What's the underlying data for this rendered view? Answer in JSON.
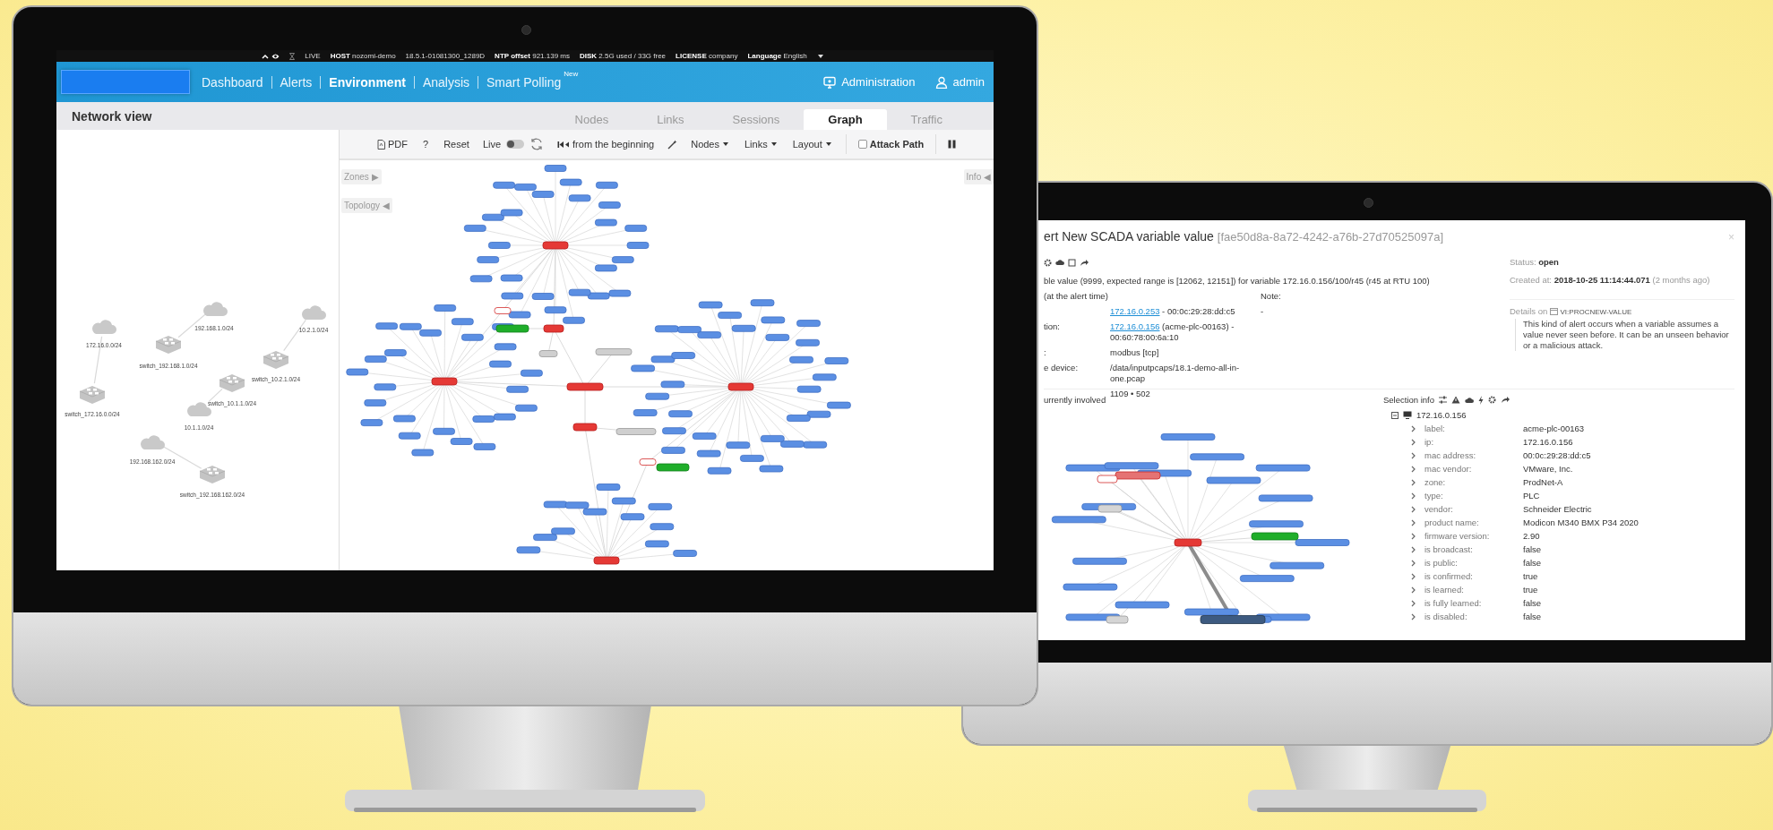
{
  "left_screen": {
    "status_bar": [
      {
        "value": "LIVE"
      },
      {
        "label": "HOST",
        "value": "nozomi-demo"
      },
      {
        "value": "18.5.1-01081300_1289D"
      },
      {
        "label": "NTP offset",
        "value": "921.139 ms"
      },
      {
        "label": "DISK",
        "value": "2.5G used / 33G free"
      },
      {
        "label": "LICENSE",
        "value": "company"
      },
      {
        "label": "Language",
        "value": "English"
      }
    ],
    "nav": {
      "items": [
        {
          "label": "Dashboard",
          "selected": false
        },
        {
          "label": "Alerts",
          "selected": false
        },
        {
          "label": "Environment",
          "selected": true
        },
        {
          "label": "Analysis",
          "selected": false
        },
        {
          "label": "Smart Polling",
          "selected": false,
          "badge": "New"
        }
      ],
      "right": [
        {
          "label": "Administration"
        },
        {
          "label": "admin"
        }
      ]
    },
    "header": {
      "title": "Network view",
      "tabs": [
        {
          "label": "Nodes",
          "selected": false
        },
        {
          "label": "Links",
          "selected": false
        },
        {
          "label": "Sessions",
          "selected": false
        },
        {
          "label": "Graph",
          "selected": true
        },
        {
          "label": "Traffic",
          "selected": false
        }
      ]
    },
    "toolbar": {
      "pdf": "PDF",
      "help": "?",
      "reset": "Reset",
      "live": {
        "label": "Live",
        "on": false
      },
      "replay": "from the beginning",
      "menus": [
        "Nodes",
        "Links",
        "Layout"
      ],
      "attack_path": {
        "label": "Attack Path",
        "checked": false
      }
    },
    "canvas": {
      "side_buttons": [
        "Zones ▶",
        "Topology ◀"
      ],
      "info_button": "Info ◀"
    },
    "topology": [
      {
        "kind": "cloud",
        "label": "172.16.0.0/24"
      },
      {
        "kind": "switch",
        "label": "switch_172.16.0.0/24"
      },
      {
        "kind": "cloud",
        "label": "192.168.1.0/24"
      },
      {
        "kind": "switch",
        "label": "switch_192.168.1.0/24"
      },
      {
        "kind": "cloud",
        "label": "10.2.1.0/24"
      },
      {
        "kind": "switch",
        "label": "switch_10.2.1.0/24"
      },
      {
        "kind": "switch",
        "label": "switch_10.1.1.0/24"
      },
      {
        "kind": "cloud",
        "label": "10.1.1.0/24"
      },
      {
        "kind": "cloud",
        "label": "192.168.162.0/24"
      },
      {
        "kind": "switch",
        "label": "switch_192.168.162.0/24"
      }
    ]
  },
  "right_screen": {
    "title": "ert New SCADA variable value",
    "alert_id": "[fae50d8a-8a72-4242-a76b-27d70525097a]",
    "close": "×",
    "description": "ble value (9999, expected range is [12062, 12151]) for variable 172.16.0.156/100/r45 (r45 at RTU 100)",
    "section_label": "(at the alert time)",
    "note_label": "Note:",
    "note_value": "-",
    "fields": [
      {
        "link": "172.16.0.253",
        "value": " - 00:0c:29:28:dd:c5"
      },
      {
        "label": "tion:",
        "link": "172.16.0.156",
        "value": " (acme-plc-00163) - 00:60:78:00:6a:10"
      },
      {
        "label": ":",
        "value": "modbus [tcp]"
      },
      {
        "label": "e device:",
        "value": "/data/inputpcaps/18.1-demo-all-in-one.pcap"
      },
      {
        "value": "1109 • 502"
      }
    ],
    "status": {
      "label": "Status:",
      "value": "open"
    },
    "created": {
      "label": "Created at:",
      "value": "2018-10-25 11:14:44.071",
      "ago": "(2 months ago)"
    },
    "details": {
      "label": "Details on",
      "code": "VI:PROCNEW-VALUE",
      "text": "This kind of alert occurs when a variable assumes a value never seen before. It can be an unseen behavior or a malicious attack."
    },
    "involved_title": "urrently involved",
    "selection_info": {
      "title": "Selection info",
      "node": "172.16.0.156",
      "properties": [
        {
          "label": "label:",
          "value": "acme-plc-00163"
        },
        {
          "label": "ip:",
          "value": "172.16.0.156"
        },
        {
          "label": "mac address:",
          "value": "00:0c:29:28:dd:c5"
        },
        {
          "label": "mac vendor:",
          "value": "VMware, Inc."
        },
        {
          "label": "zone:",
          "value": "ProdNet-A"
        },
        {
          "label": "type:",
          "value": "PLC"
        },
        {
          "label": "vendor:",
          "value": "Schneider Electric"
        },
        {
          "label": "product name:",
          "value": "Modicon M340 BMX P34 2020"
        },
        {
          "label": "firmware version:",
          "value": "2.90"
        },
        {
          "label": "is broadcast:",
          "value": "false"
        },
        {
          "label": "is public:",
          "value": "false"
        },
        {
          "label": "is confirmed:",
          "value": "true"
        },
        {
          "label": "is learned:",
          "value": "true"
        },
        {
          "label": "is fully learned:",
          "value": "false"
        },
        {
          "label": "is disabled:",
          "value": "false"
        }
      ]
    }
  }
}
